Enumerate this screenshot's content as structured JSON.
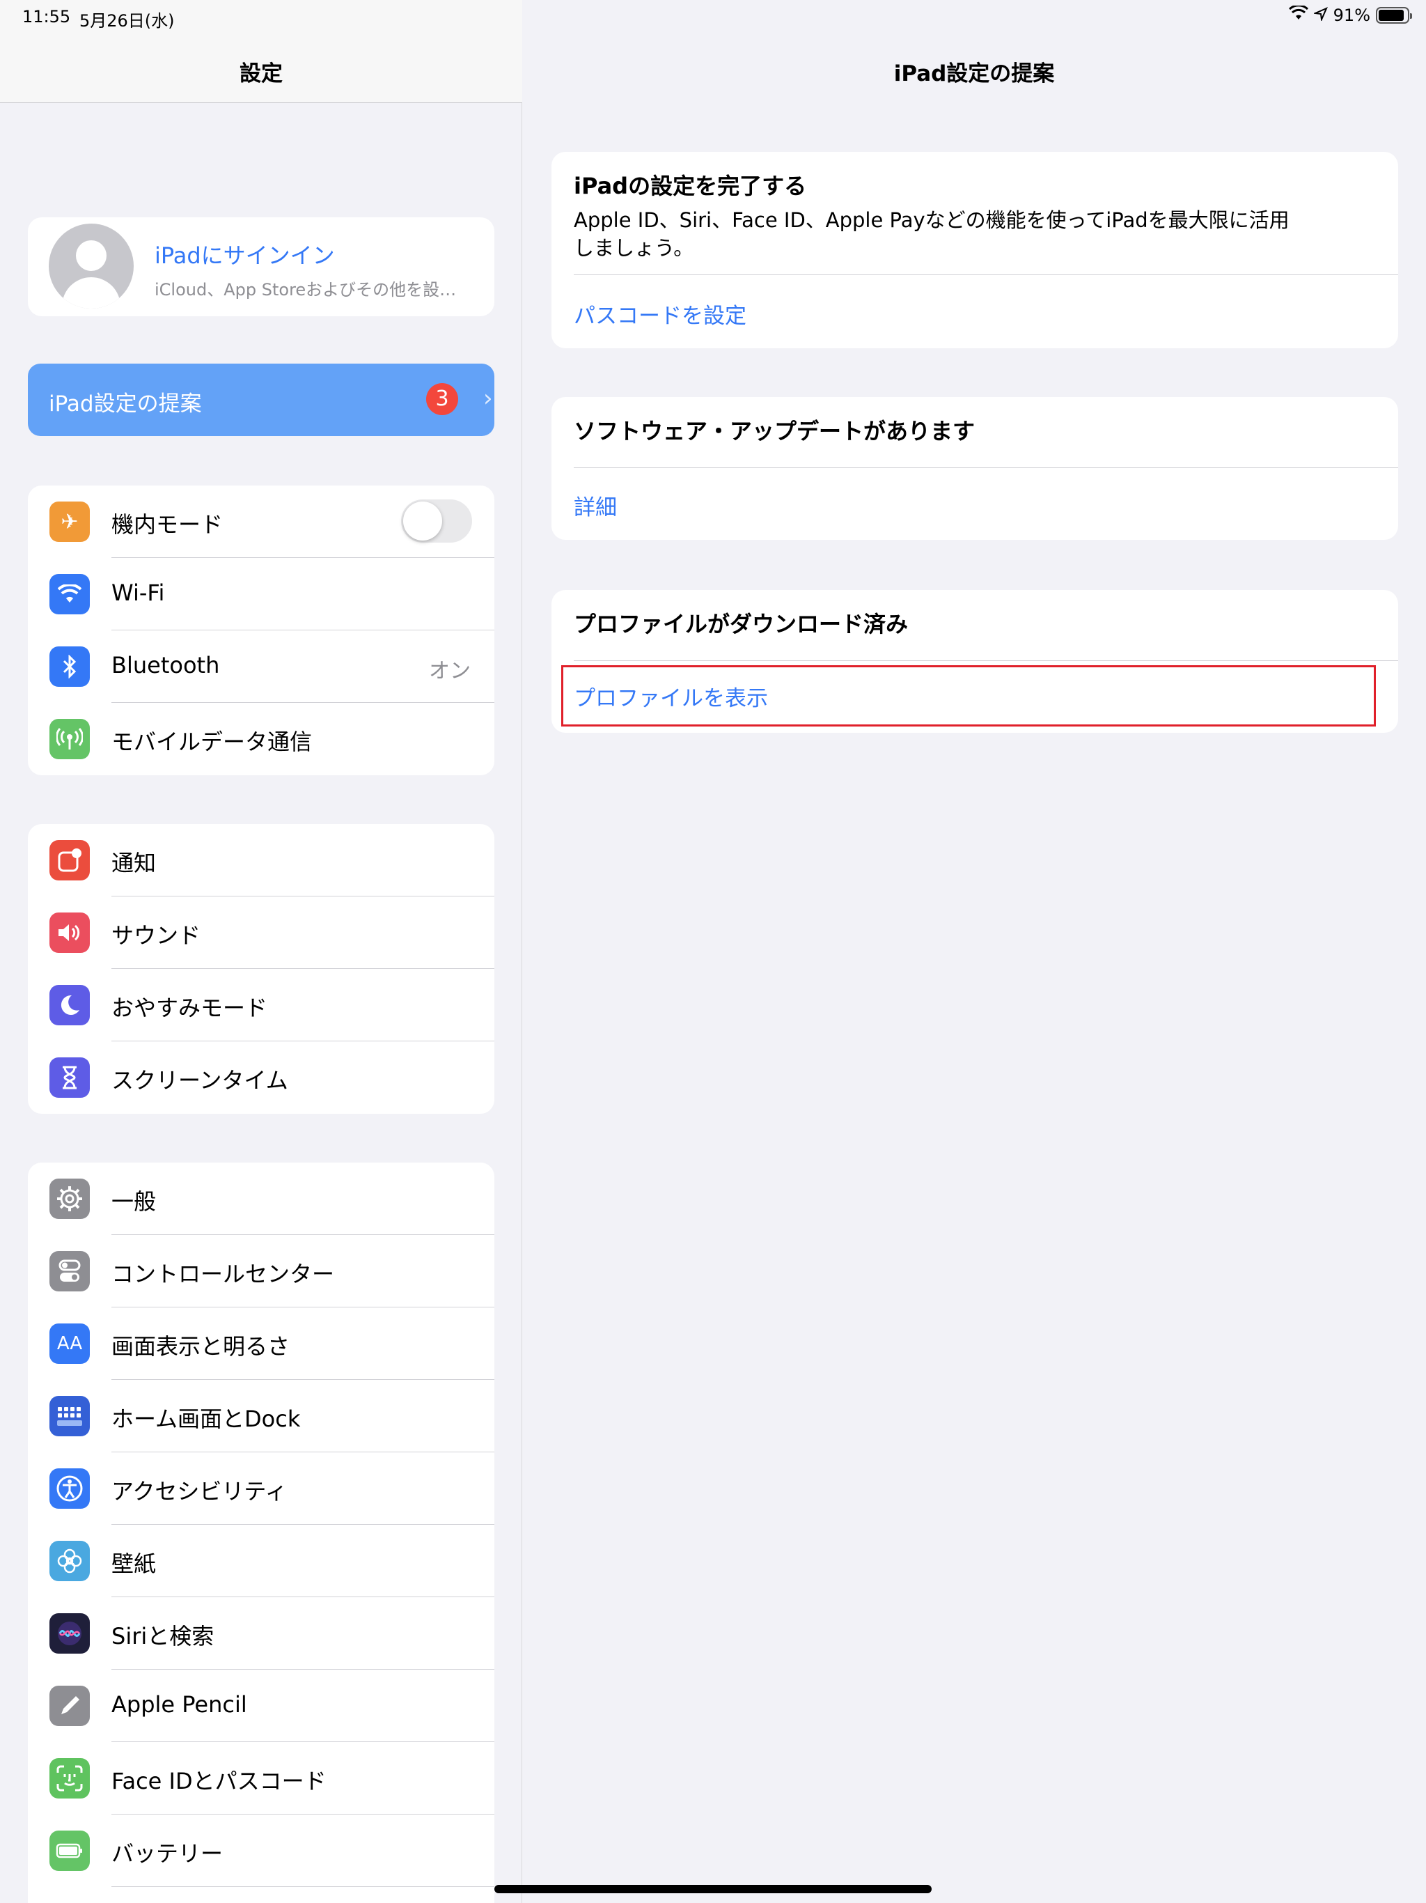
{
  "status": {
    "time": "11:55",
    "date": "5月26日(水)",
    "battery_text": "91%",
    "battery_level": 0.91
  },
  "sidebar": {
    "title": "設定",
    "profile": {
      "name": "iPadにサインイン",
      "subtitle": "iCloud、App Storeおよびその他を設…"
    },
    "suggestion": {
      "label": "iPad設定の提案",
      "badge": "3"
    },
    "group1": [
      {
        "label": "機内モード",
        "icon": "airplane-icon",
        "color": "#f19a37",
        "glyph": "✈"
      },
      {
        "label": "Wi-Fi",
        "icon": "wifi-icon",
        "color": "#3478f6",
        "glyph": "📶"
      },
      {
        "label": "Bluetooth",
        "icon": "bluetooth-icon",
        "color": "#3478f6",
        "glyph": "ᛒ",
        "value": "オン"
      },
      {
        "label": "モバイルデータ通信",
        "icon": "antenna-icon",
        "color": "#64c466",
        "glyph": "((•))"
      }
    ],
    "group2": [
      {
        "label": "通知",
        "icon": "notifications-icon",
        "color": "#eb4d3d",
        "glyph": "▢"
      },
      {
        "label": "サウンド",
        "icon": "speaker-icon",
        "color": "#eb4e5e",
        "glyph": "🔊"
      },
      {
        "label": "おやすみモード",
        "icon": "moon-icon",
        "color": "#5e5ce6",
        "glyph": "☾"
      },
      {
        "label": "スクリーンタイム",
        "icon": "hourglass-icon",
        "color": "#5e5ce6",
        "glyph": "⧗"
      }
    ],
    "group3": [
      {
        "label": "一般",
        "icon": "gear-icon",
        "color": "#8e8e93",
        "glyph": "⚙"
      },
      {
        "label": "コントロールセンター",
        "icon": "toggles-icon",
        "color": "#8e8e93",
        "glyph": "◐"
      },
      {
        "label": "画面表示と明るさ",
        "icon": "text-size-icon",
        "color": "#3478f6",
        "glyph": "AA"
      },
      {
        "label": "ホーム画面とDock",
        "icon": "home-grid-icon",
        "color": "#3460d6",
        "glyph": "▦"
      },
      {
        "label": "アクセシビリティ",
        "icon": "accessibility-icon",
        "color": "#3478f6",
        "glyph": "♿"
      },
      {
        "label": "壁紙",
        "icon": "flower-icon",
        "color": "#4aa8e0",
        "glyph": "❀"
      },
      {
        "label": "Siriと検索",
        "icon": "siri-icon",
        "color": "#1f1f3a",
        "glyph": "◉"
      },
      {
        "label": "Apple Pencil",
        "icon": "pencil-icon",
        "color": "#8e8e93",
        "glyph": "✎"
      },
      {
        "label": "Face IDとパスコード",
        "icon": "face-id-icon",
        "color": "#5fc35f",
        "glyph": "☺"
      },
      {
        "label": "バッテリー",
        "icon": "battery-icon",
        "color": "#64c466",
        "glyph": "▭"
      }
    ]
  },
  "detail": {
    "title": "iPad設定の提案",
    "cards": [
      {
        "title": "iPadの設定を完了する",
        "description": "Apple ID、Siri、Face ID、Apple Payなどの機能を使ってiPadを最大限に活用しましょう。",
        "link": "パスコードを設定"
      },
      {
        "title": "ソフトウェア・アップデートがあります",
        "link": "詳細"
      },
      {
        "title": "プロファイルがダウンロード済み",
        "link": "プロファイルを表示"
      }
    ]
  }
}
